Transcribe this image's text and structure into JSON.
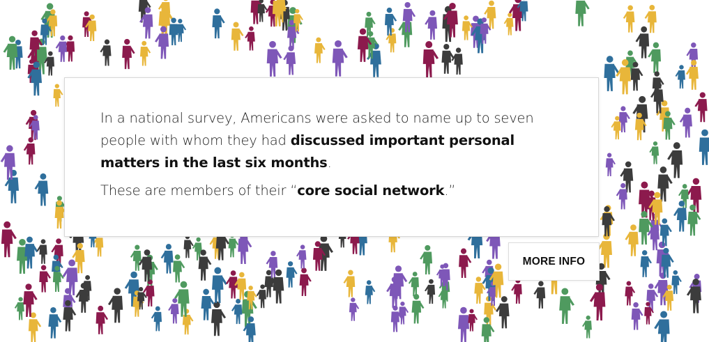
{
  "intro": {
    "p1_pre": "In a national survey, Americans were asked to name up to seven people with whom they had ",
    "p1_bold": "discussed important personal matters in the last six months",
    "p1_post": ".",
    "p2_pre": "These are members of their “",
    "p2_bold": "core social network",
    "p2_post": ".”"
  },
  "more_info_label": "MORE INFO",
  "colors": {
    "purple": "#7e57b8",
    "teal": "#2f6f9c",
    "gold": "#e8b63a",
    "green": "#4f9a5f",
    "magenta": "#8c1a4d",
    "dark": "#3c3c3c"
  }
}
